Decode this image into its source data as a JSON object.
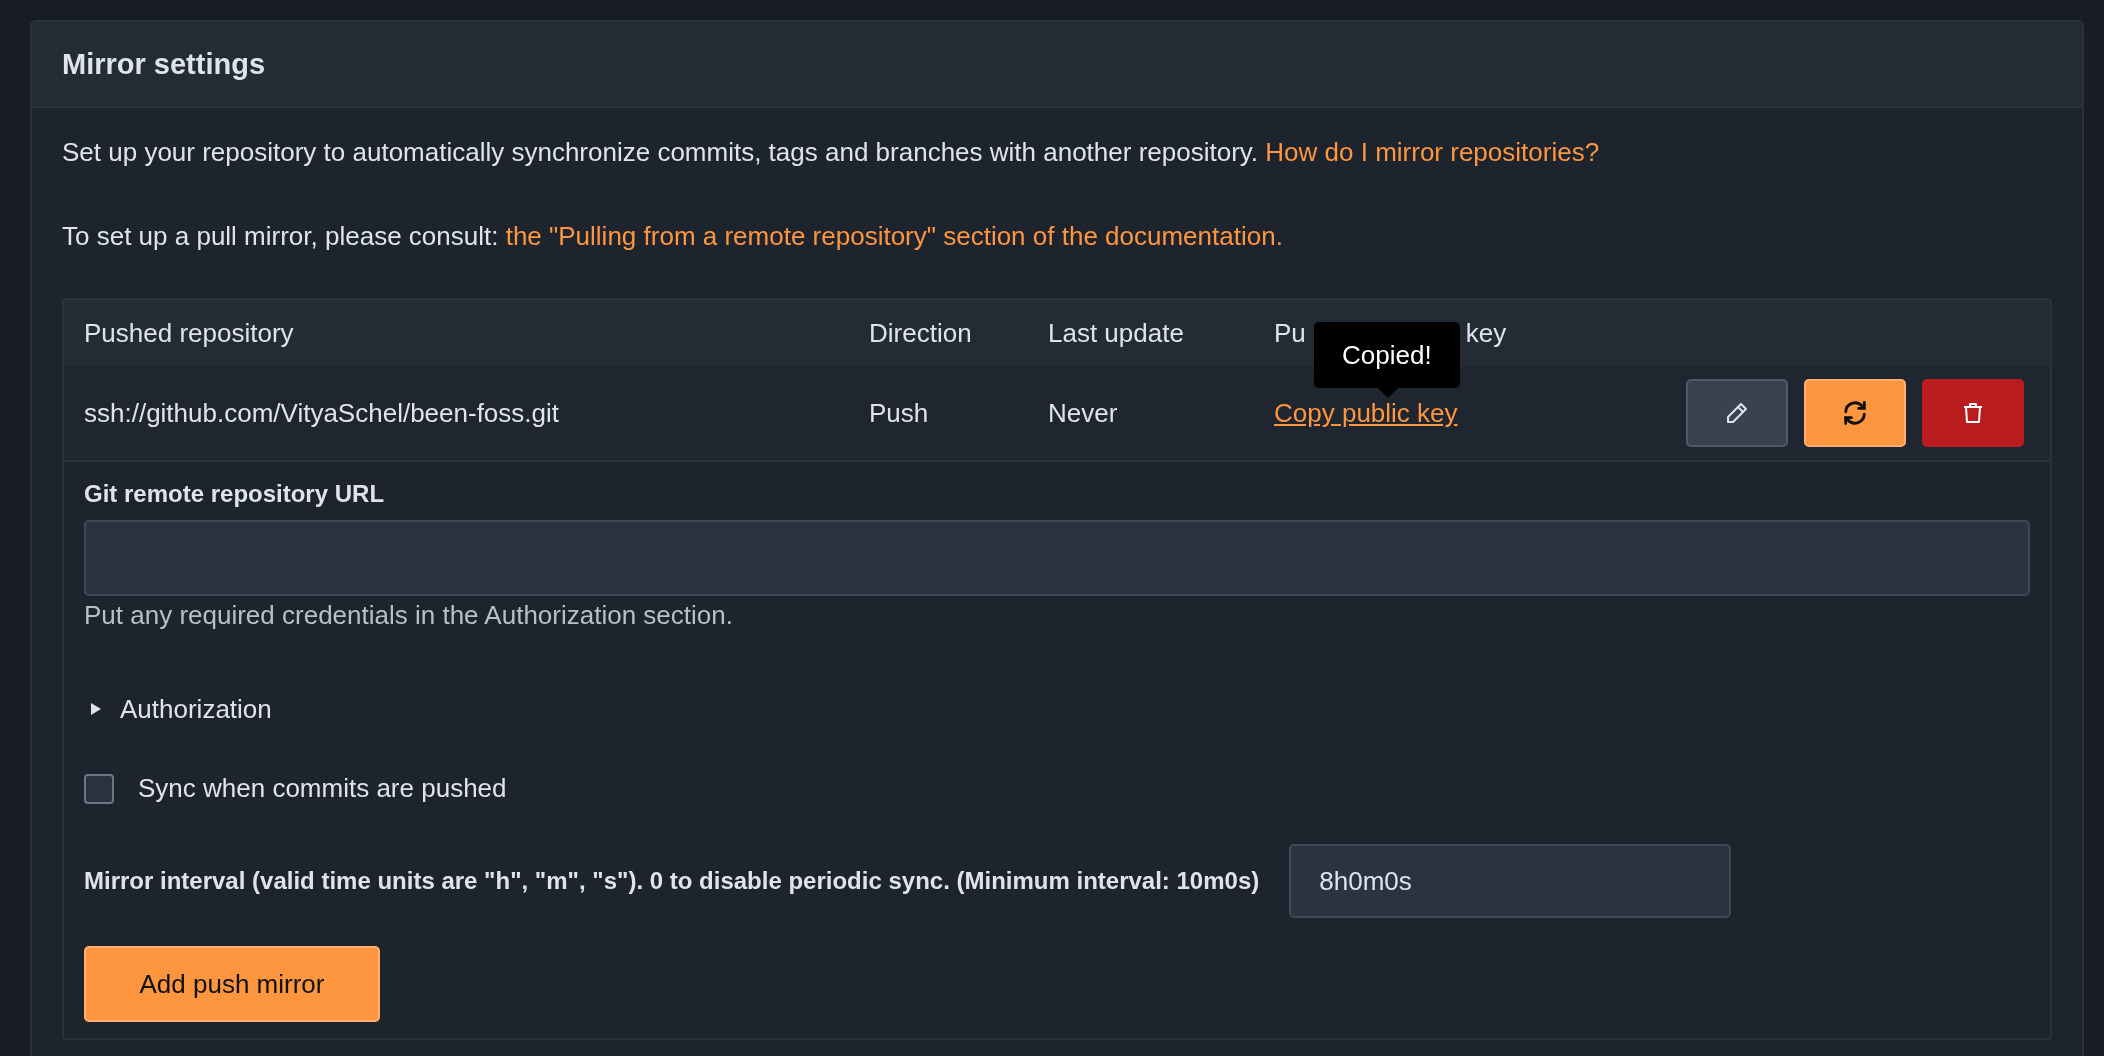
{
  "panel": {
    "title": "Mirror settings"
  },
  "intro": {
    "text": "Set up your repository to automatically synchronize commits, tags and branches with another repository.",
    "link": "How do I mirror repositories?"
  },
  "pull_note": {
    "text": "To set up a pull mirror, please consult:",
    "link": "the \"Pulling from a remote repository\" section of the documentation."
  },
  "table": {
    "columns": [
      {
        "parts": [
          "Pushed repository"
        ]
      },
      {
        "parts": [
          "Direction"
        ]
      },
      {
        "parts": [
          "Last update"
        ]
      },
      {
        "parts": [
          "Pu",
          "key"
        ]
      }
    ],
    "rows": [
      {
        "repository": "ssh://github.com/VityaSchel/been-foss.git",
        "direction": "Push",
        "last_update": "Never",
        "key_link": "Copy public key"
      }
    ]
  },
  "tooltip": "Copied!",
  "form": {
    "url_label": "Git remote repository URL",
    "url_hint": "Put any required credentials in the Authorization section.",
    "authorization": {
      "label": "Authorization",
      "expanded": false
    },
    "sync_checkbox": {
      "label": "Sync when commits are pushed",
      "checked": false
    },
    "interval_label": "Mirror interval (valid time units are \"h\", \"m\", \"s\"). 0 to disable periodic sync. (Minimum interval: 10m0s)",
    "interval_value": "8h0m0s",
    "submit": "Add push mirror"
  }
}
